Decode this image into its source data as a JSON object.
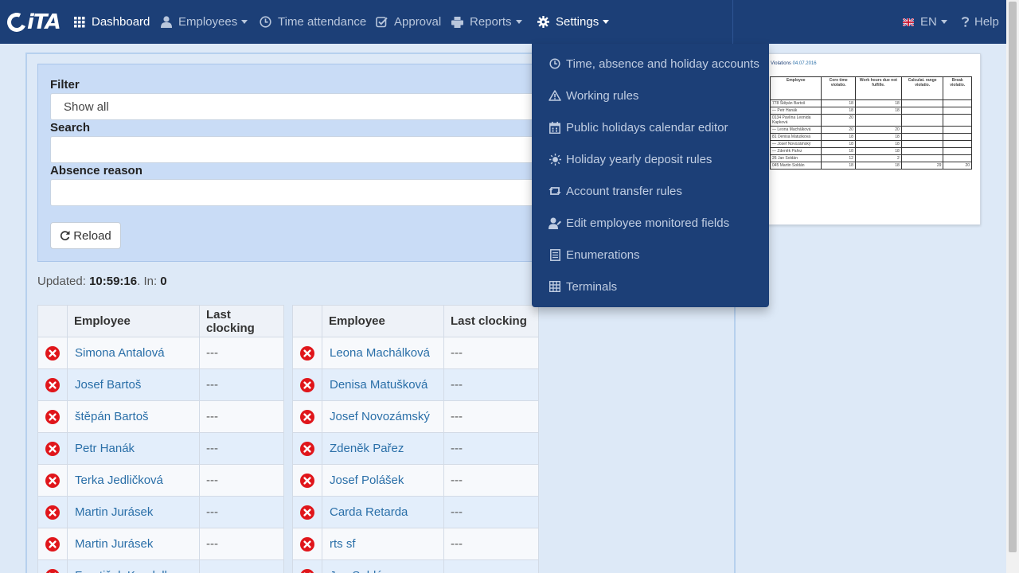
{
  "brand": {
    "logo_text": "iTA"
  },
  "nav": {
    "dashboard": "Dashboard",
    "employees": "Employees",
    "time_attendance": "Time attendance",
    "approval": "Approval",
    "reports": "Reports",
    "settings": "Settings",
    "language": "EN",
    "help": "Help"
  },
  "settings_menu": [
    {
      "label": "Time, absence and holiday accounts",
      "icon": "clock-icon"
    },
    {
      "label": "Working rules",
      "icon": "warning-icon"
    },
    {
      "label": "Public holidays calendar editor",
      "icon": "calendar-icon"
    },
    {
      "label": "Holiday yearly deposit rules",
      "icon": "sun-icon"
    },
    {
      "label": "Account transfer rules",
      "icon": "transfer-icon"
    },
    {
      "label": "Edit employee monitored fields",
      "icon": "user-edit-icon"
    },
    {
      "label": "Enumerations",
      "icon": "list-icon"
    },
    {
      "label": "Terminals",
      "icon": "grid-icon"
    }
  ],
  "filter": {
    "label": "Filter",
    "value": "Show all",
    "search_label": "Search",
    "search_value": "",
    "absence_label": "Absence reason",
    "absence_value": "",
    "reload": "Reload"
  },
  "status": {
    "updated_prefix": "Updated:",
    "time": "10:59:16",
    "in_prefix": ". In:",
    "in_count": "0"
  },
  "table_headers": {
    "employee": "Employee",
    "last_clocking": "Last clocking"
  },
  "left_rows": [
    {
      "name": "Simona Antalová",
      "last": "---"
    },
    {
      "name": "Josef Bartoš",
      "last": "---"
    },
    {
      "name": "štěpán Bartoš",
      "last": "---"
    },
    {
      "name": "Petr Hanák",
      "last": "---"
    },
    {
      "name": "Terka Jedličková",
      "last": "---"
    },
    {
      "name": "Martin Jurásek",
      "last": "---"
    },
    {
      "name": "Martin Jurásek",
      "last": "---"
    },
    {
      "name": "František Koudelka",
      "last": "---"
    }
  ],
  "right_rows": [
    {
      "name": "Leona Machálková",
      "last": "---"
    },
    {
      "name": "Denisa Matušková",
      "last": "---"
    },
    {
      "name": "Josef Novozámský",
      "last": "---"
    },
    {
      "name": "Zdeněk Pařez",
      "last": "---"
    },
    {
      "name": "Josef Polášek",
      "last": "---"
    },
    {
      "name": "Carda Retarda",
      "last": "---"
    },
    {
      "name": "rts sf",
      "last": "---"
    },
    {
      "name": "Jan Soldán",
      "last": "---"
    }
  ],
  "report": {
    "title": "Violations",
    "date": "04.07.2016",
    "headers": [
      "Employee",
      "Core time violatio.",
      "Work hours due not fulfille.",
      "Calculat. range violatio.",
      "Break violatio."
    ],
    "rows": [
      [
        "778 Štěpán Bartoš",
        "18",
        "18",
        "",
        ""
      ],
      [
        "— Petr Hanák",
        "18",
        "18",
        "",
        ""
      ],
      [
        "0134 Pavlína Leonida Kapková",
        "20",
        "",
        "",
        ""
      ],
      [
        "— Leona Machálková",
        "20",
        "20",
        "",
        ""
      ],
      [
        "81 Denisa Matušková",
        "18",
        "18",
        "",
        ""
      ],
      [
        "— Josef Novozámský",
        "18",
        "18",
        "",
        ""
      ],
      [
        "— Zdeněk Pařez",
        "18",
        "18",
        "",
        ""
      ],
      [
        "26 Jan Soldán",
        "12",
        "2",
        "",
        ""
      ],
      [
        "045 Martin Soldán",
        "18",
        "18",
        "29",
        "20"
      ]
    ]
  },
  "colors": {
    "navbar": "#1c3f77",
    "accent_link": "#2a6fa8",
    "absent_icon": "#e0161b"
  }
}
